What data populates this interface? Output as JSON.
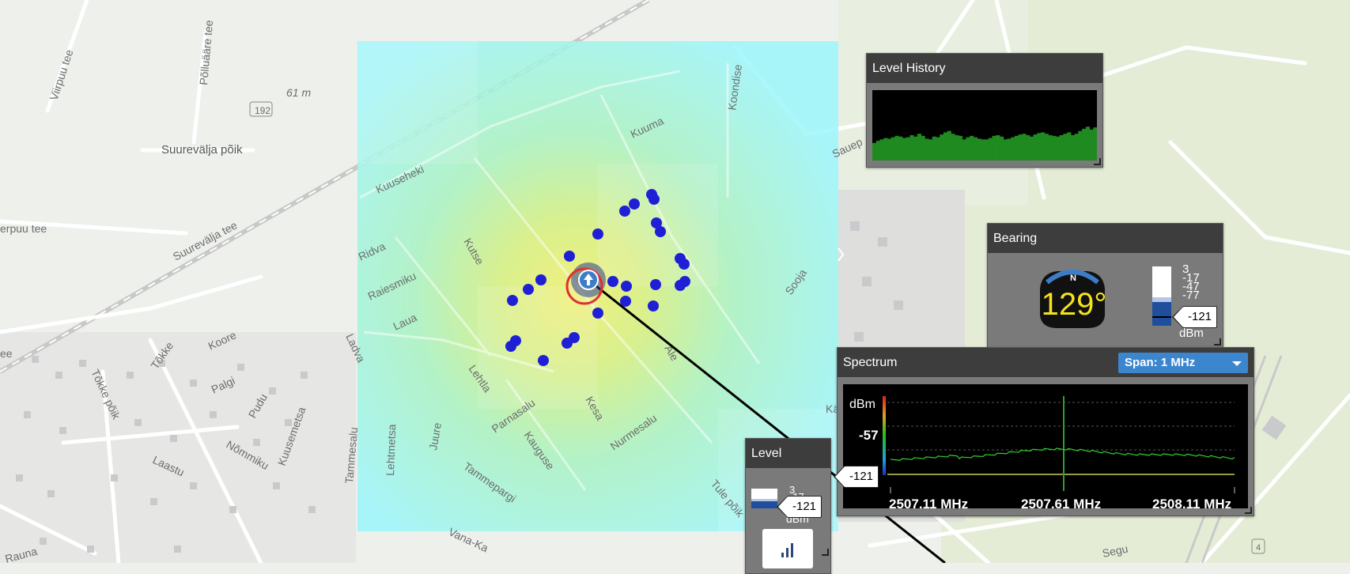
{
  "map": {
    "street_labels": [
      "Viirpuu tee",
      "Põlluääre tee",
      "61 m",
      "192",
      "Suurevälja põik",
      "Suurevälja tee",
      "erpuu tee",
      "Kuuseheki",
      "Kuuma",
      "Koondise",
      "Sauep",
      "Ridva",
      "Kutse",
      "Raiesmiku",
      "Laua",
      "Sooja",
      "Ale",
      "Ladva",
      "Lehtla",
      "Tõkke",
      "Koore",
      "Palgi",
      "Pudu",
      "Tõkke põik",
      "Nõmmiku",
      "Kuusemetsa",
      "Laastu",
      "Tammesalu",
      "Lehtmetsa",
      "Juure",
      "Parnasalu",
      "Kesa",
      "Kauguse",
      "Nurmesalu",
      "Tammepargi",
      "Vana-Ka",
      "Rauna",
      "Tule põik",
      "Segu",
      "ee",
      "Kä",
      "4"
    ],
    "colors": {
      "marker": "#1f1fd6",
      "heat_cold": "#9cf6fb",
      "heat_warm": "#e3ef7a",
      "ring": "#e03030"
    }
  },
  "level_history": {
    "title": "Level History",
    "levels": [
      0.25,
      0.28,
      0.3,
      0.32,
      0.31,
      0.33,
      0.35,
      0.34,
      0.32,
      0.33,
      0.36,
      0.34,
      0.38,
      0.35,
      0.31,
      0.3,
      0.34,
      0.33,
      0.37,
      0.4,
      0.42,
      0.38,
      0.36,
      0.35,
      0.3,
      0.33,
      0.35,
      0.33,
      0.31,
      0.3,
      0.3,
      0.32,
      0.35,
      0.36,
      0.34,
      0.3,
      0.31,
      0.33,
      0.35,
      0.37,
      0.38,
      0.36,
      0.34,
      0.37,
      0.39,
      0.4,
      0.38,
      0.36,
      0.35,
      0.34,
      0.36,
      0.38,
      0.4,
      0.36,
      0.38,
      0.42,
      0.45,
      0.48,
      0.44,
      0.47
    ],
    "bar_color": "#1f8a1f"
  },
  "bearing": {
    "title": "Bearing",
    "value": "129°",
    "compass_label": "N",
    "scale_ticks": [
      "3",
      "-17",
      "-47",
      "-77"
    ],
    "unit": "dBm",
    "level": "-121"
  },
  "spectrum": {
    "title": "Spectrum",
    "span_label": "Span: 1 MHz",
    "unit": "dBm",
    "tick_mid": "-57",
    "level": "-121",
    "freq_labels": [
      "2507.11 MHz",
      "2507.61 MHz",
      "2508.11 MHz"
    ]
  },
  "level": {
    "title": "Level",
    "scale_ticks": [
      "3",
      "-17"
    ],
    "unit": "dBm",
    "level": "-121"
  }
}
